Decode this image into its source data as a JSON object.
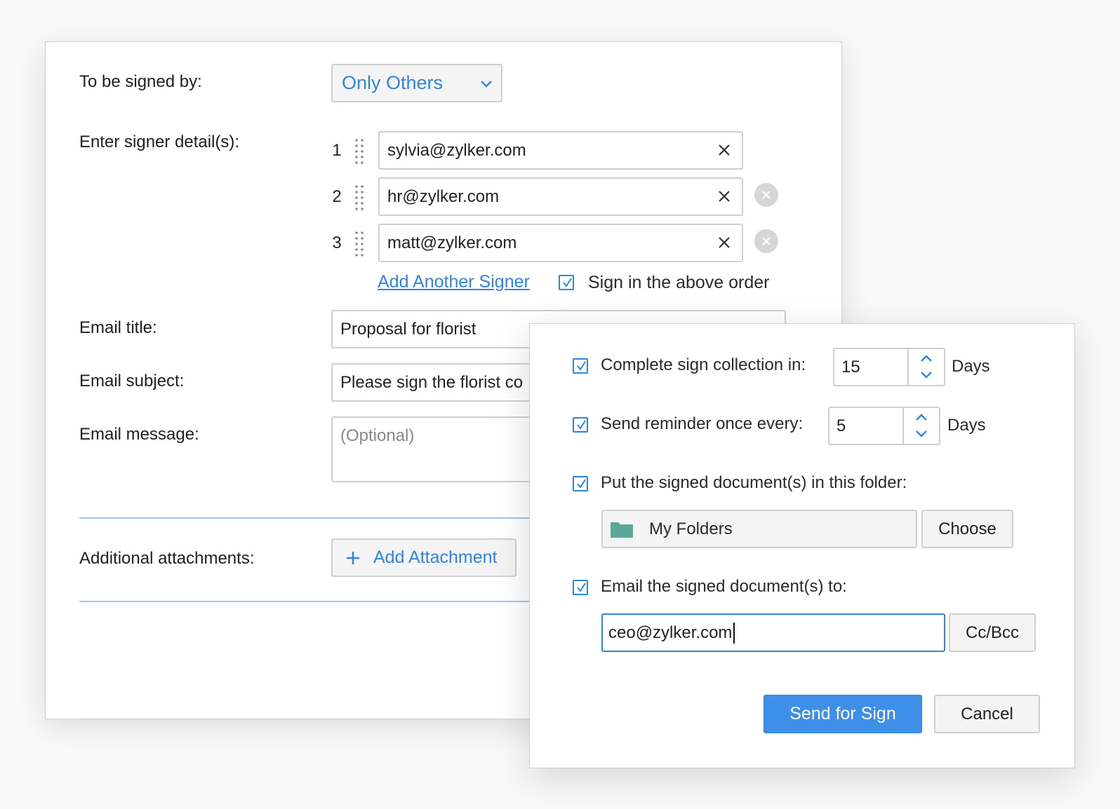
{
  "form": {
    "signed_by_label": "To be signed by:",
    "signed_by_value": "Only Others",
    "signer_details_label": "Enter signer detail(s):",
    "signers": [
      {
        "number": "1",
        "email": "sylvia@zylker.com"
      },
      {
        "number": "2",
        "email": "hr@zylker.com"
      },
      {
        "number": "3",
        "email": "matt@zylker.com"
      }
    ],
    "add_signer_link": "Add Another Signer",
    "sign_order_label": "Sign in the above order",
    "email_title_label": "Email title:",
    "email_title_value": "Proposal for florist",
    "email_subject_label": "Email subject:",
    "email_subject_value": "Please sign the florist co",
    "email_message_label": "Email message:",
    "email_message_placeholder": "(Optional)",
    "attachments_label": "Additional attachments:",
    "add_attachment_label": "Add Attachment"
  },
  "dialog": {
    "complete_label": "Complete sign collection in:",
    "complete_value": "15",
    "complete_unit": "Days",
    "reminder_label": "Send reminder once every:",
    "reminder_value": "5",
    "reminder_unit": "Days",
    "folder_label": "Put the signed document(s) in this folder:",
    "folder_value": "My Folders",
    "choose_label": "Choose",
    "email_to_label": "Email the signed document(s) to:",
    "email_to_value": "ceo@zylker.com",
    "ccbcc_label": "Cc/Bcc",
    "send_label": "Send for Sign",
    "cancel_label": "Cancel"
  },
  "colors": {
    "accent": "#2f86e0",
    "primary_button": "#3d8fe8",
    "folder_icon": "#5aa89a",
    "border": "#cfcfcf",
    "divider": "#9ec4ee"
  },
  "icons": [
    "chevron-down-icon",
    "drag-handle-icon",
    "close-icon",
    "remove-circle-icon",
    "checkmark-icon",
    "plus-icon",
    "chevron-up-icon",
    "folder-icon"
  ]
}
